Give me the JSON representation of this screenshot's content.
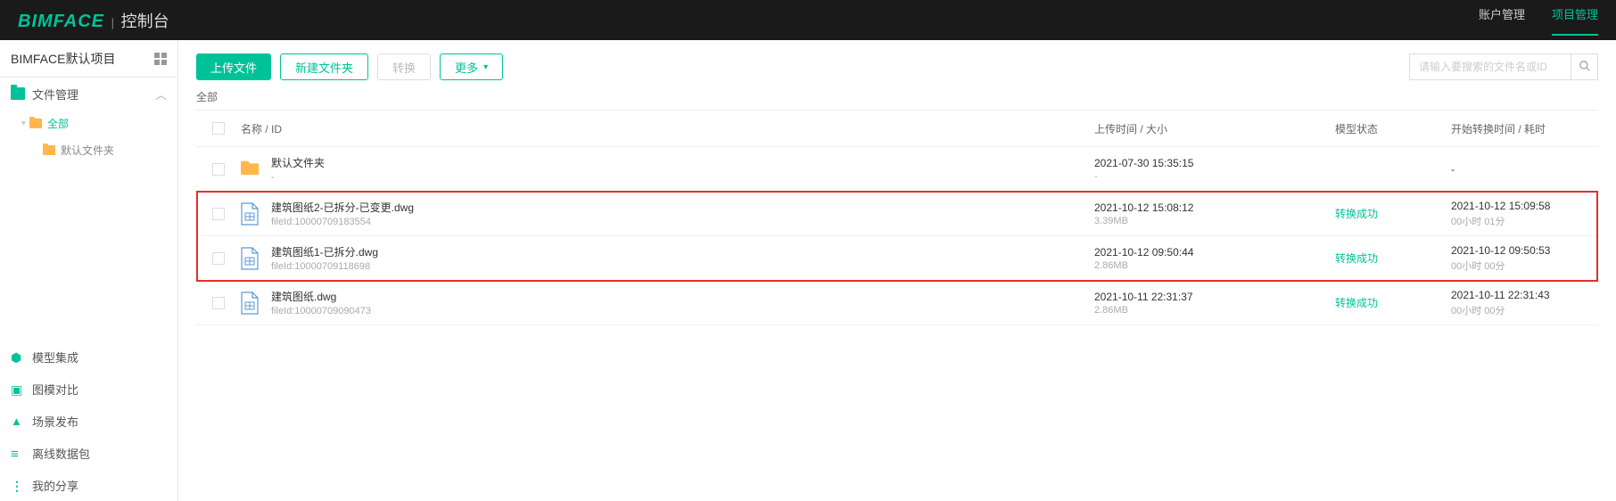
{
  "header": {
    "logo_main": "BIMFACE",
    "logo_sub": "控制台",
    "nav_account": "账户管理",
    "nav_project": "项目管理"
  },
  "sidebar": {
    "project_name": "BIMFACE默认项目",
    "file_mgmt": "文件管理",
    "tree_all": "全部",
    "tree_default": "默认文件夹",
    "nav_model": "模型集成",
    "nav_compare": "图模对比",
    "nav_scene": "场景发布",
    "nav_offline": "离线数据包",
    "nav_share": "我的分享"
  },
  "toolbar": {
    "upload": "上传文件",
    "new_folder": "新建文件夹",
    "convert": "转换",
    "more": "更多",
    "search_placeholder": "请输入要搜索的文件名或ID"
  },
  "breadcrumb": "全部",
  "columns": {
    "name": "名称 / ID",
    "time": "上传时间 / 大小",
    "status": "模型状态",
    "convert": "开始转换时间 / 耗时"
  },
  "rows": [
    {
      "type": "folder",
      "name": "默认文件夹",
      "sub": "-",
      "time": "2021-07-30 15:35:15",
      "size": "-",
      "status": "",
      "start": "-",
      "dur": ""
    },
    {
      "type": "dwg",
      "name": "建筑图纸2-已拆分-已变更.dwg",
      "sub": "fileId:10000709183554",
      "time": "2021-10-12 15:08:12",
      "size": "3.39MB",
      "status": "转换成功",
      "start": "2021-10-12 15:09:58",
      "dur": "00小时 01分"
    },
    {
      "type": "dwg",
      "name": "建筑图纸1-已拆分.dwg",
      "sub": "fileId:10000709118698",
      "time": "2021-10-12 09:50:44",
      "size": "2.86MB",
      "status": "转换成功",
      "start": "2021-10-12 09:50:53",
      "dur": "00小时 00分"
    },
    {
      "type": "dwg",
      "name": "建筑图纸.dwg",
      "sub": "fileId:10000709090473",
      "time": "2021-10-11 22:31:37",
      "size": "2.86MB",
      "status": "转换成功",
      "start": "2021-10-11 22:31:43",
      "dur": "00小时 00分"
    }
  ]
}
